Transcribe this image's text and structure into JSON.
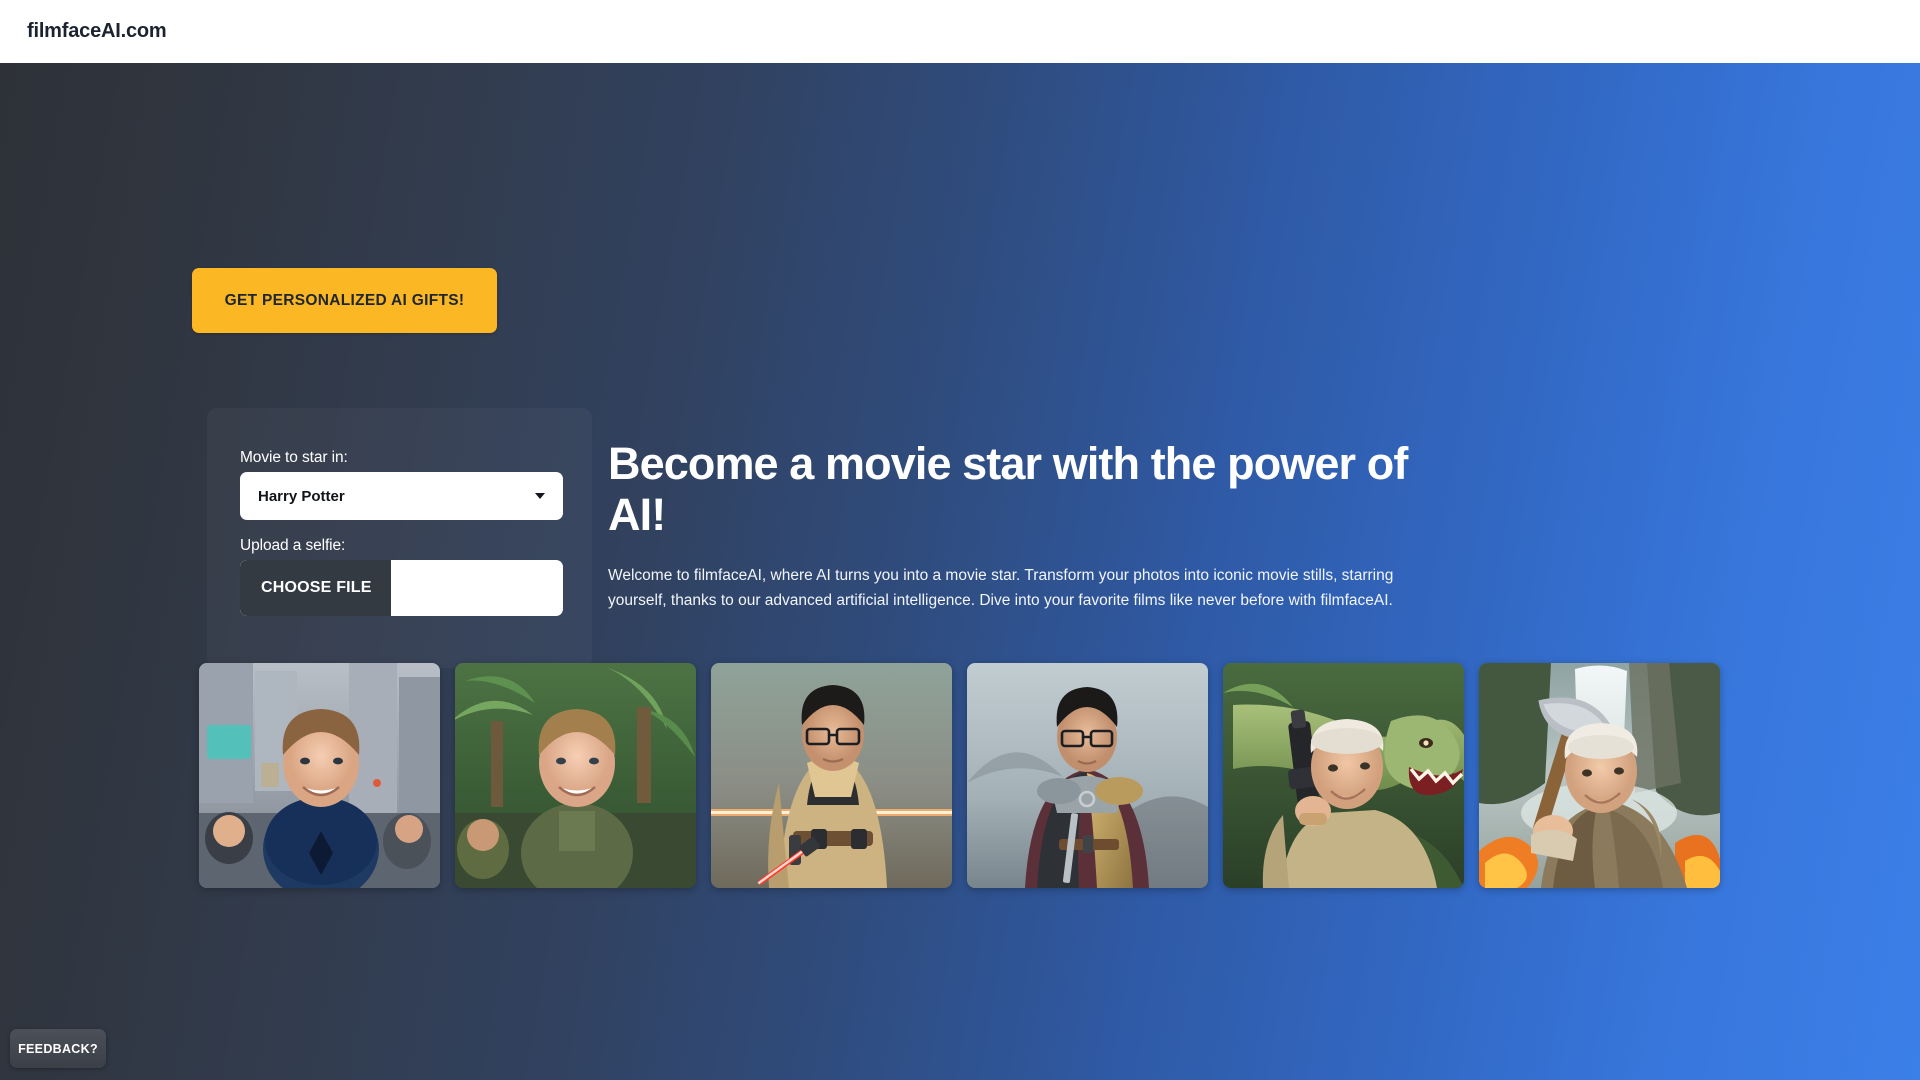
{
  "navbar": {
    "brand": "filmfaceAI.com"
  },
  "hero": {
    "cta_label": "GET PERSONALIZED AI GIFTS!",
    "headline": "Become a movie star with the power of AI!",
    "lede": "Welcome to filmfaceAI, where AI turns you into a movie star. Transform your photos into iconic movie stills, starring yourself, thanks to our advanced artificial intelligence. Dive into your favorite films like never before with filmfaceAI."
  },
  "form": {
    "movie_label": "Movie to star in:",
    "movie_value": "Harry Potter",
    "upload_label": "Upload a selfie:",
    "choose_file_label": "CHOOSE FILE",
    "file_name": ""
  },
  "gallery": {
    "items": [
      {
        "name": "spider-hero-city",
        "alt": "Man in blue and black spider suit smiling on a crowded city street"
      },
      {
        "name": "jungle-explorer",
        "alt": "Man in olive safari shirt smiling in a tropical jungle"
      },
      {
        "name": "jedi-lightsaber",
        "alt": "Man with glasses in tan Jedi robes holding a red lightsaber"
      },
      {
        "name": "armored-knight",
        "alt": "Man with glasses in gold armor and red cape on a misty coast"
      },
      {
        "name": "dinosaur-chase",
        "alt": "Older man in khaki holding a weapon with a green dinosaur behind him"
      },
      {
        "name": "axe-warrior-waterfall",
        "alt": "Older man in brown robes raising an axe before a waterfall and fire"
      }
    ]
  },
  "feedback": {
    "label": "FEEDBACK?"
  },
  "colors": {
    "accent_amber": "#fbb724",
    "gradient_left": "#2e3138",
    "gradient_right": "#3b7fe8",
    "choose_file_dark": "#343a42"
  }
}
